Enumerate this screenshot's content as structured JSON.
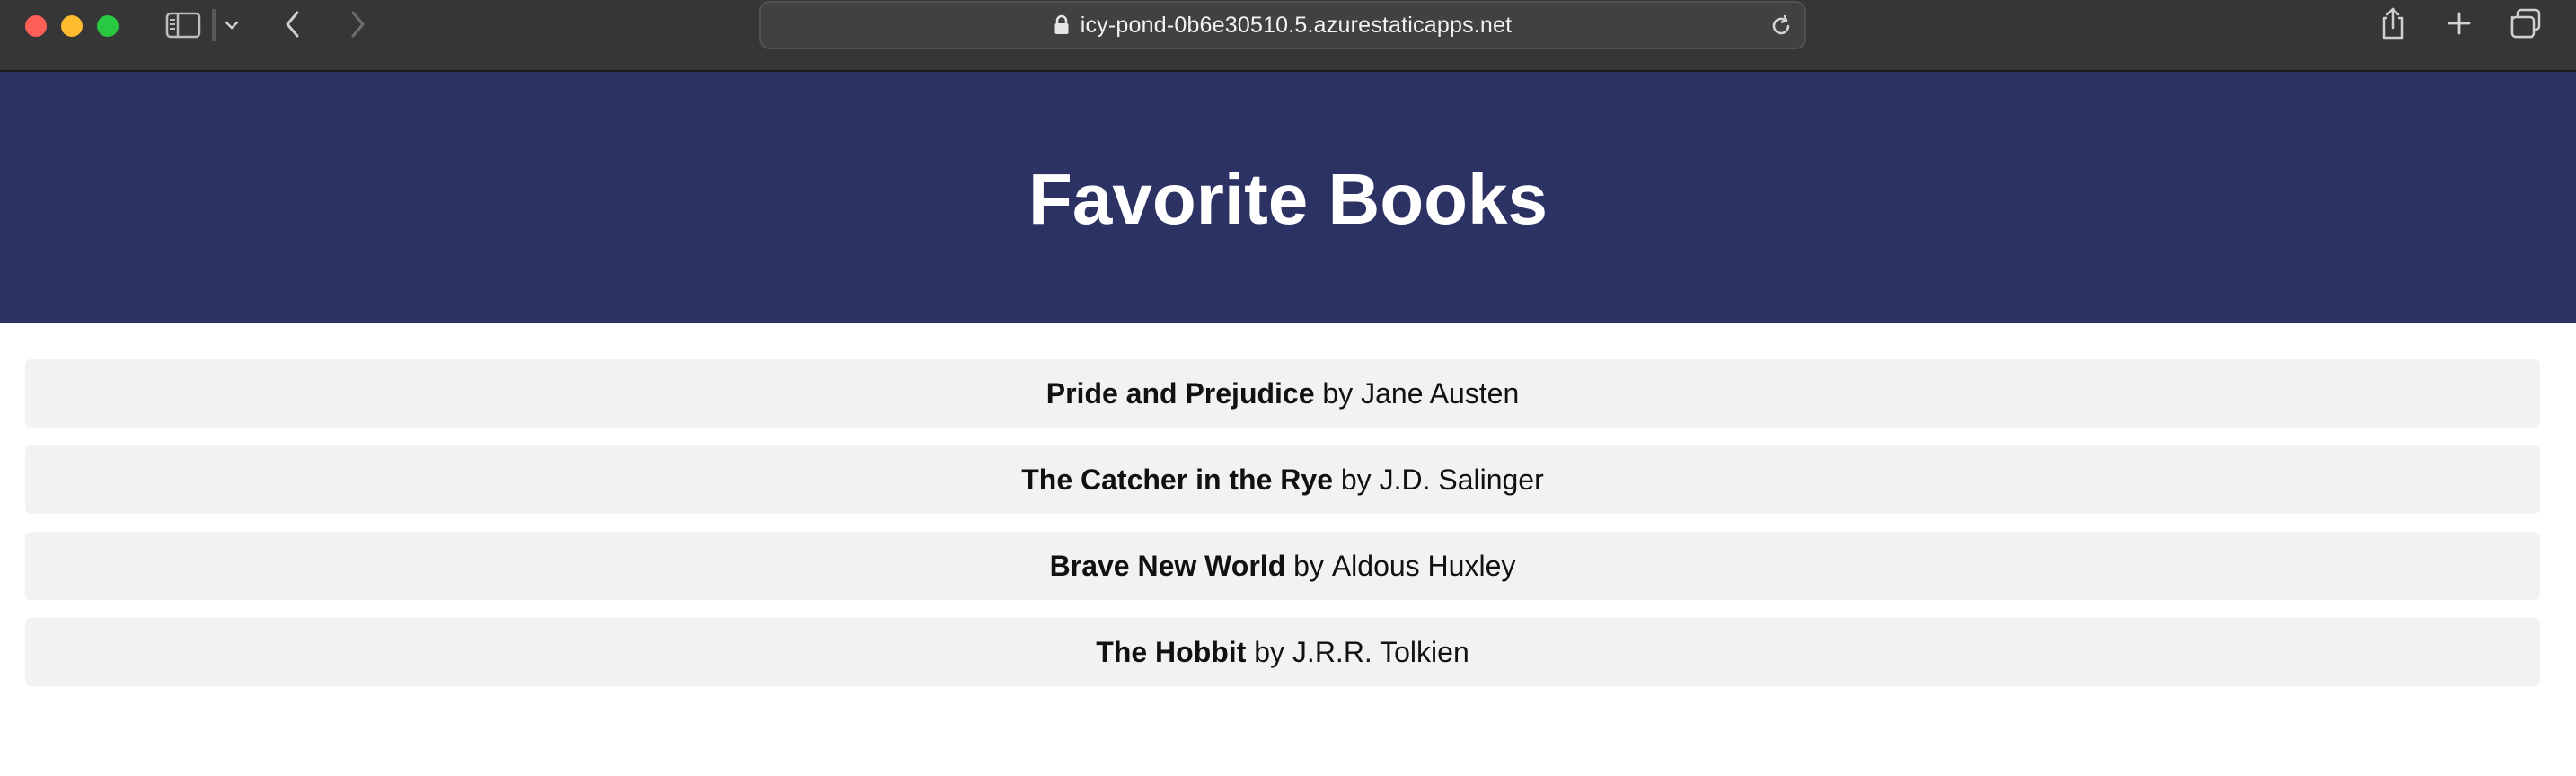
{
  "browser": {
    "url": "icy-pond-0b6e30510.5.azurestaticapps.net",
    "icons": {
      "sidebar": "sidebar-icon",
      "chevron": "chevron-down-icon",
      "back": "back-arrow-icon",
      "forward": "forward-arrow-icon",
      "lock": "lock-icon",
      "reload": "reload-icon",
      "share": "share-icon",
      "new_tab": "plus-icon",
      "tabs": "tab-overview-icon"
    },
    "colors": {
      "close": "#ff5f57",
      "minimize": "#febc2e",
      "zoom": "#28c840"
    }
  },
  "page": {
    "title": "Favorite Books",
    "header_color": "#2d3264",
    "by_word": "by",
    "books": [
      {
        "title": "Pride and Prejudice",
        "author": "Jane Austen"
      },
      {
        "title": "The Catcher in the Rye",
        "author": "J.D. Salinger"
      },
      {
        "title": "Brave New World",
        "author": "Aldous Huxley"
      },
      {
        "title": "The Hobbit",
        "author": "J.R.R. Tolkien"
      }
    ]
  }
}
